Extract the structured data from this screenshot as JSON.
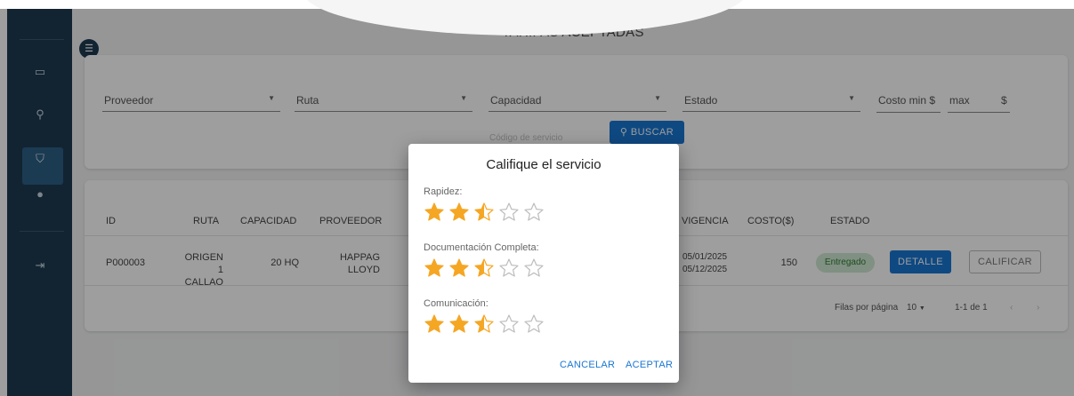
{
  "page": {
    "title": "TARIFAS ACEPTADAS"
  },
  "sidebar": {
    "items": [
      {
        "icon": "inbox-icon",
        "glyph": "▭"
      },
      {
        "icon": "search-icon",
        "glyph": "⚲"
      },
      {
        "icon": "badge-icon",
        "glyph": "⛉",
        "active": true
      },
      {
        "icon": "check-circle-icon",
        "glyph": "●"
      },
      {
        "icon": "logout-icon",
        "glyph": "⇥"
      }
    ]
  },
  "filters": {
    "proveedor": "Proveedor",
    "ruta": "Ruta",
    "capacidad": "Capacidad",
    "estado": "Estado",
    "costo_min": "Costo min $",
    "costo_max": "max",
    "costo_unit": "$",
    "search_placeholder": "Código de servicio",
    "search_button": "BUSCAR"
  },
  "table": {
    "columns": {
      "id": "ID",
      "ruta": "RUTA",
      "capacidad": "CAPACIDAD",
      "proveedor": "PROVEEDOR",
      "vigencia": "VIGENCIA",
      "costo": "COSTO($)",
      "estado": "ESTADO"
    },
    "rows": [
      {
        "id": "P000003",
        "ruta_origen": "ORIGEN 1",
        "ruta_destino": "CALLAO",
        "capacidad": "20 HQ",
        "proveedor_1": "HAPPAG",
        "proveedor_2": "LLOYD",
        "vigencia_desde": "05/01/2025",
        "vigencia_hasta": "05/12/2025",
        "costo": "150",
        "estado": "Entregado",
        "detalle": "DETALLE",
        "calificar": "CALIFICAR"
      }
    ],
    "pagination": {
      "rows_per_page_label": "Filas por página",
      "rows_per_page": "10",
      "range": "1-1 de 1"
    }
  },
  "dialog": {
    "title": "Califique el servicio",
    "criteria": [
      {
        "label": "Rapidez:",
        "rating": 2.5,
        "max": 5
      },
      {
        "label": "Documentación Completa:",
        "rating": 2.5,
        "max": 5
      },
      {
        "label": "Comunicación:",
        "rating": 2.5,
        "max": 5
      }
    ],
    "cancel": "CANCELAR",
    "accept": "ACEPTAR"
  },
  "colors": {
    "sidebar": "#1d3a52",
    "primary": "#1976d2",
    "star": "#f5a623",
    "star_empty": "#bdbdbd",
    "badge_bg": "#cfe8d2",
    "badge_text": "#2e7d32"
  }
}
